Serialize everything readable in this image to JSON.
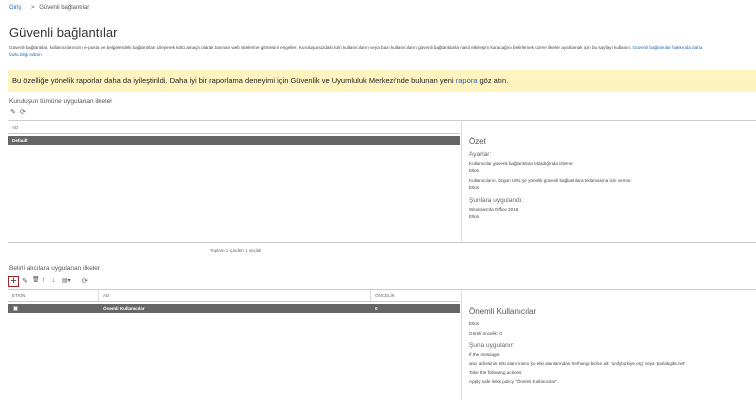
{
  "breadcrumb": {
    "home": "Giriş",
    "sep": ">",
    "current": "Güvenli bağlantılar"
  },
  "page_title": "Güvenli bağlantılar",
  "description": {
    "text": "Güvenli bağlantılar, kullanıcılarınızın e-posta ve belgelerdeki bağlantıları izleyerek kötü amaçlı olarak tanınan web sitelerine gitmesini engeller. Kuruluşunuzdaki tüm kullanıcıların veya bazı kullanıcıların güvenli bağlantılarla nasıl etkileşim kuracağını belirlemek üzere ilkeler ayarlamak için bu sayfayı kullanın.",
    "link1": "Güvenli bağlantılar hakkında daha",
    "link2": "fazla bilgi edinin"
  },
  "notice": {
    "text_before": "Bu özelliğe yönelik raporlar daha da iyileştirildi. Daha iyi bir raporlama deneyimi için Güvenlik ve Uyumluluk Merkezi'nde bulunan yeni ",
    "link": "rapora",
    "text_after": " göz atın."
  },
  "org_section": {
    "title": "Kuruluşun tümüne uygulanan ilkeler",
    "col_name": "AD",
    "row": "Default",
    "count": "Toplam 1 içinden 1 seçildi"
  },
  "org_details": {
    "summary": "Özet",
    "settings": "Ayarlar:",
    "s1": "Kullanıcılar güvenli bağlantılara tıkladığında izleme:",
    "s1v": "Etkin",
    "s2": "Kullanıcıların, özgün URL'ye yönelik güvenli bağlantılara tıklamasına izin verme:",
    "s2v": "Etkin",
    "applies": "Şunlara uygulandı:",
    "a1": "Windows'da Office 2016",
    "a1v": "Etkin"
  },
  "recip_section": {
    "title": "Belirli alıcılara uygulanan ilkeler",
    "col_enabled": "ETKİN",
    "col_name": "AD",
    "col_priority": "ÖNCELİK",
    "row_name": "Önemli Kullanıcılar",
    "row_priority": "0"
  },
  "recip_details": {
    "title": "Önemli Kullanıcılar",
    "status": "Etkin",
    "priority": "Göreli öncelik: 0",
    "applies": "Şuna uygulanır:",
    "l1": "If the message:",
    "l2": "alıcı adresinin etki alanı kısmı şu etki alanlarından herhangi birine ait: 'unifyturkiye.org' veya 'parlakgibt.net'",
    "l3": "Take the following actions:",
    "l4": "Apply safe links policy \"Önemli Kullanıcılar\"."
  },
  "icons": {
    "edit": "✎",
    "refresh": "⟳",
    "plus": "+",
    "delete": "🗑",
    "up": "↑",
    "down": "↓",
    "more": "▤▾"
  }
}
